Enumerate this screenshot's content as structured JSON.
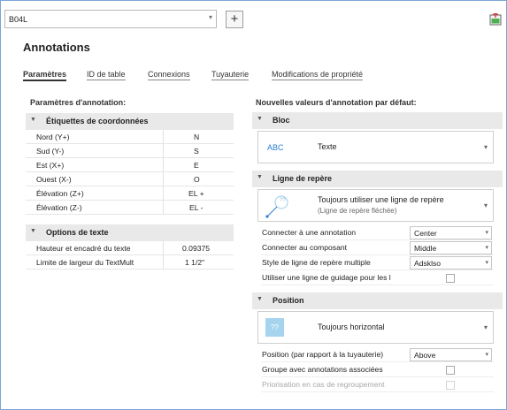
{
  "top": {
    "style_value": "B04L",
    "add_label": "+"
  },
  "page_title": "Annotations",
  "tabs": [
    {
      "label": "Paramètres",
      "active": true
    },
    {
      "label": "ID de table"
    },
    {
      "label": "Connexions"
    },
    {
      "label": "Tuyauterie"
    },
    {
      "label": "Modifications de propriété"
    }
  ],
  "left": {
    "heading": "Paramètres d'annotation:",
    "coords": {
      "title": "Étiquettes de coordonnées",
      "rows": [
        {
          "label": "Nord (Y+)",
          "value": "N"
        },
        {
          "label": "Sud (Y-)",
          "value": "S"
        },
        {
          "label": "Est (X+)",
          "value": "E"
        },
        {
          "label": "Ouest (X-)",
          "value": "O"
        },
        {
          "label": "Élévation (Z+)",
          "value": "EL +"
        },
        {
          "label": "Élévation (Z-)",
          "value": "EL -"
        }
      ]
    },
    "text_options": {
      "title": "Options de texte",
      "rows": [
        {
          "label": "Hauteur et encadré du texte",
          "value": "0.09375"
        },
        {
          "label": "Limite de largeur du TextMult",
          "value": "1 1/2\""
        }
      ]
    }
  },
  "right": {
    "heading": "Nouvelles valeurs d'annotation par défaut:",
    "bloc": {
      "title": "Bloc",
      "preview": "ABC",
      "value": "Texte"
    },
    "leader": {
      "title": "Ligne de repère",
      "icon_text": "??",
      "value": "Toujours utiliser une ligne de repère",
      "subvalue": "(Ligne de repère fléchée)",
      "rows": [
        {
          "label": "Connecter à une annotation",
          "type": "select",
          "value": "Center"
        },
        {
          "label": "Connecter au composant",
          "type": "select",
          "value": "Middle"
        },
        {
          "label": "Style de ligne de repère multiple",
          "type": "select",
          "value": "Adsklso"
        },
        {
          "label": "Utiliser une ligne de guidage pour les l",
          "type": "check"
        }
      ]
    },
    "position": {
      "title": "Position",
      "icon_text": "??",
      "value": "Toujours horizontal",
      "rows": [
        {
          "label": "Position (par rapport à la tuyauterie)",
          "type": "select",
          "value": "Above"
        },
        {
          "label": "Groupe avec annotations associées",
          "type": "check"
        },
        {
          "label": "Priorisation en cas de regroupement",
          "type": "check",
          "disabled": true
        }
      ]
    }
  },
  "colors": {
    "frame_border": "#7aa5d6",
    "section_bg": "#e9e9e9",
    "abc_blue": "#2a7fd4",
    "icon_box": "#a6d4ee"
  },
  "icons": [
    "chevron-down-icon",
    "plus-icon",
    "export-icon",
    "collapse-triangle-icon",
    "leader-arrow-icon",
    "checkbox-icon"
  ]
}
